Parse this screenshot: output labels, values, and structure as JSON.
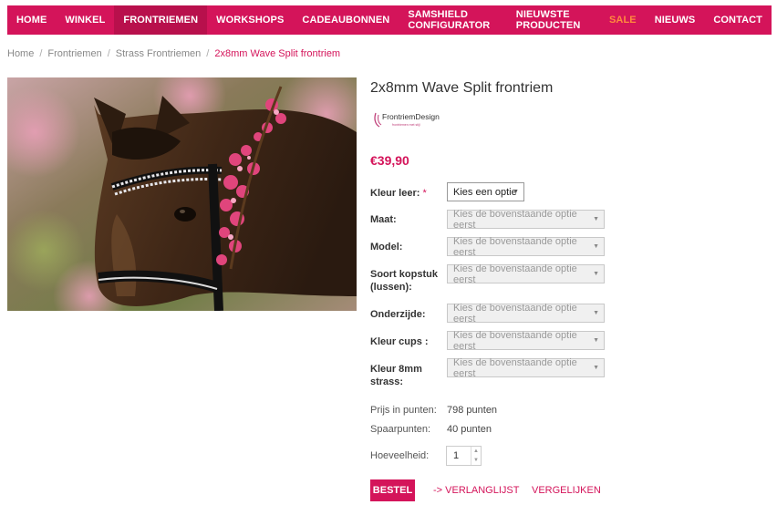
{
  "nav": {
    "items": [
      {
        "label": "HOME"
      },
      {
        "label": "WINKEL"
      },
      {
        "label": "FRONTRIEMEN"
      },
      {
        "label": "WORKSHOPS"
      },
      {
        "label": "CADEAUBONNEN"
      },
      {
        "label": "SAMSHIELD CONFIGURATOR"
      },
      {
        "label": "NIEUWSTE PRODUCTEN"
      },
      {
        "label": "SALE"
      },
      {
        "label": "NIEUWS"
      },
      {
        "label": "CONTACT"
      }
    ],
    "active_index": 2,
    "colors": {
      "bar": "#d4145a",
      "active": "#b8104c",
      "sale": "#ff8a3d"
    }
  },
  "breadcrumb": {
    "items": [
      "Home",
      "Frontriemen",
      "Strass Frontriemen"
    ],
    "separator": "/",
    "current": "2x8mm Wave Split frontriem"
  },
  "product": {
    "title": "2x8mm Wave Split frontriem",
    "brand": {
      "name": "FrontriemDesign",
      "tagline": "frontriemen met stijl"
    },
    "price": "€39,90",
    "image_icon": "horse-photo"
  },
  "options": [
    {
      "label": "Kleur leer:",
      "required_mark": "*",
      "value": "Kies een optie",
      "enabled": true
    },
    {
      "label": "Maat:",
      "value": "Kies de bovenstaande optie eerst",
      "enabled": false
    },
    {
      "label": "Model:",
      "value": "Kies de bovenstaande optie eerst",
      "enabled": false
    },
    {
      "label": "Soort kopstuk (lussen):",
      "value": "Kies de bovenstaande optie eerst",
      "enabled": false
    },
    {
      "label": "Onderzijde:",
      "value": "Kies de bovenstaande optie eerst",
      "enabled": false
    },
    {
      "label": "Kleur cups :",
      "value": "Kies de bovenstaande optie eerst",
      "enabled": false
    },
    {
      "label": "Kleur 8mm strass:",
      "value": "Kies de bovenstaande optie eerst",
      "enabled": false
    }
  ],
  "points": {
    "price_label": "Prijs in punten:",
    "price_value": "798 punten",
    "saving_label": "Spaarpunten:",
    "saving_value": "40 punten"
  },
  "quantity": {
    "label": "Hoeveelheid:",
    "value": "1"
  },
  "actions": {
    "order_label": "BESTEL",
    "wishlist_label": "-> VERLANGLIJST",
    "compare_label": "VERGELIJKEN"
  }
}
